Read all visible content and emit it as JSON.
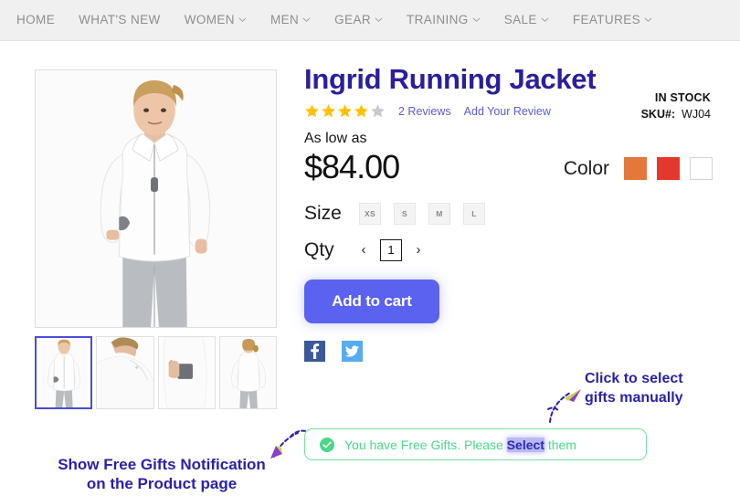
{
  "nav": {
    "items": [
      {
        "label": "HOME",
        "has_dropdown": false
      },
      {
        "label": "WHAT'S NEW",
        "has_dropdown": false
      },
      {
        "label": "WOMEN",
        "has_dropdown": true
      },
      {
        "label": "MEN",
        "has_dropdown": true
      },
      {
        "label": "GEAR",
        "has_dropdown": true
      },
      {
        "label": "TRAINING",
        "has_dropdown": true
      },
      {
        "label": "SALE",
        "has_dropdown": true
      },
      {
        "label": "FEATURES",
        "has_dropdown": true
      }
    ]
  },
  "product": {
    "title": "Ingrid Running Jacket",
    "rating_filled": 4,
    "rating_total": 5,
    "reviews_label": "2 Reviews",
    "add_review_label": "Add Your Review",
    "price_prefix": "As low as",
    "price": "$84.00",
    "stock_status": "IN STOCK",
    "sku_label": "SKU#:",
    "sku_value": "WJ04",
    "size_label": "Size",
    "sizes": [
      "XS",
      "S",
      "M",
      "L"
    ],
    "color_label": "Color",
    "colors": [
      "#e2783a",
      "#e5382c",
      "#ffffff"
    ],
    "qty_label": "Qty",
    "qty_value": "1",
    "qty_decrement": "‹",
    "qty_increment": "›",
    "add_to_cart_label": "Add to cart",
    "share": [
      {
        "name": "facebook-share-icon",
        "glyph": "f"
      },
      {
        "name": "twitter-share-icon",
        "glyph": "t"
      }
    ],
    "thumbnails": [
      {
        "alt": "front view",
        "selected": true
      },
      {
        "alt": "collar detail",
        "selected": false
      },
      {
        "alt": "pocket detail",
        "selected": false
      },
      {
        "alt": "back view",
        "selected": false
      }
    ]
  },
  "notification": {
    "icon": "check-circle-icon",
    "text_before": "You have Free Gifts. Please ",
    "text_selected": "Select",
    "text_after": " them"
  },
  "annotations": {
    "left_line1": "Show Free Gifts Notification",
    "left_line2": "on the Product page",
    "right_line1": "Click to select",
    "right_line2": "gifts manually"
  },
  "colors": {
    "title": "#2a1f9e",
    "accent_button": "#5b62f0",
    "notification_green": "#49d888",
    "star_filled": "#ffc107",
    "star_empty": "#c9c9c9",
    "annotation": "#2a22a8"
  }
}
